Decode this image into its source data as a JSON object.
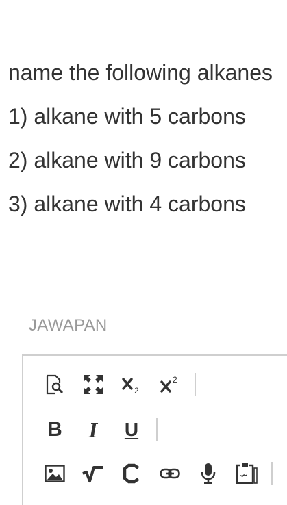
{
  "question": {
    "title": "name the following alkanes",
    "items": [
      "1) alkane with 5 carbons",
      "2) alkane with 9 carbons",
      "3) alkane with 4 carbons"
    ]
  },
  "answer": {
    "label": "JAWAPAN"
  },
  "toolbar": {
    "bold_label": "B",
    "italic_label": "I",
    "underline_label": "U",
    "icons": {
      "preview": "preview-icon",
      "fullscreen": "fullscreen-icon",
      "subscript": "subscript-icon",
      "superscript": "superscript-icon",
      "image": "image-icon",
      "math": "math-icon",
      "chemistry": "chemistry-icon",
      "link": "link-icon",
      "record": "microphone-icon",
      "paste": "paste-icon"
    }
  }
}
